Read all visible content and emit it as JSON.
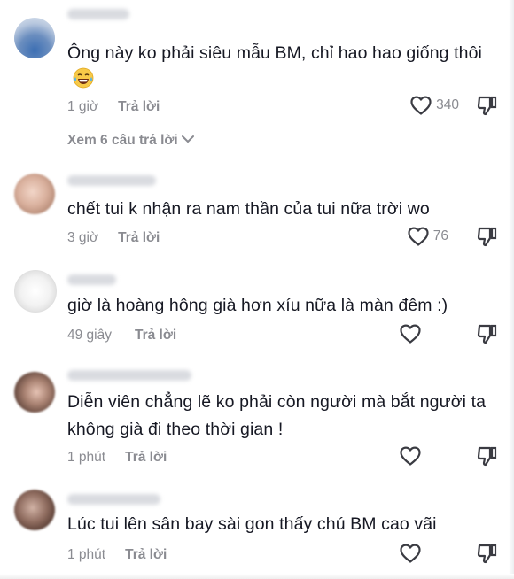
{
  "comments": [
    {
      "text": "Ông này ko phải siêu mẫu BM, chỉ hao hao giống thôi",
      "emoji_name": "laughing-tears-emoji",
      "time": "1 giờ",
      "reply_label": "Trả lời",
      "likes": "340",
      "replies_label": "Xem 6 câu trả lời"
    },
    {
      "text": "chết tui k nhận ra nam thần của tui nữa trời wo",
      "time": "3 giờ",
      "reply_label": "Trả lời",
      "likes": "76"
    },
    {
      "text": "giờ là hoàng hông già hơn xíu nữa là màn đêm :)",
      "time": "49 giây",
      "reply_label": "Trả lời",
      "likes": ""
    },
    {
      "text": "Diễn viên chẳng lẽ ko phải còn người mà bắt người ta không già đi theo thời gian !",
      "time": "1 phút",
      "reply_label": "Trả lời",
      "likes": ""
    },
    {
      "text": "Lúc tui lên sân bay sài gon thấy chú BM cao vãi",
      "time": "1 phút",
      "reply_label": "Trả lời",
      "likes": ""
    }
  ],
  "icons": {
    "like": "heart-outline-icon",
    "dislike": "thumbs-down-outline-icon",
    "expand": "chevron-down-icon"
  },
  "colors": {
    "text": "#161823",
    "secondary": "#8a8b91",
    "background": "#ffffff"
  }
}
